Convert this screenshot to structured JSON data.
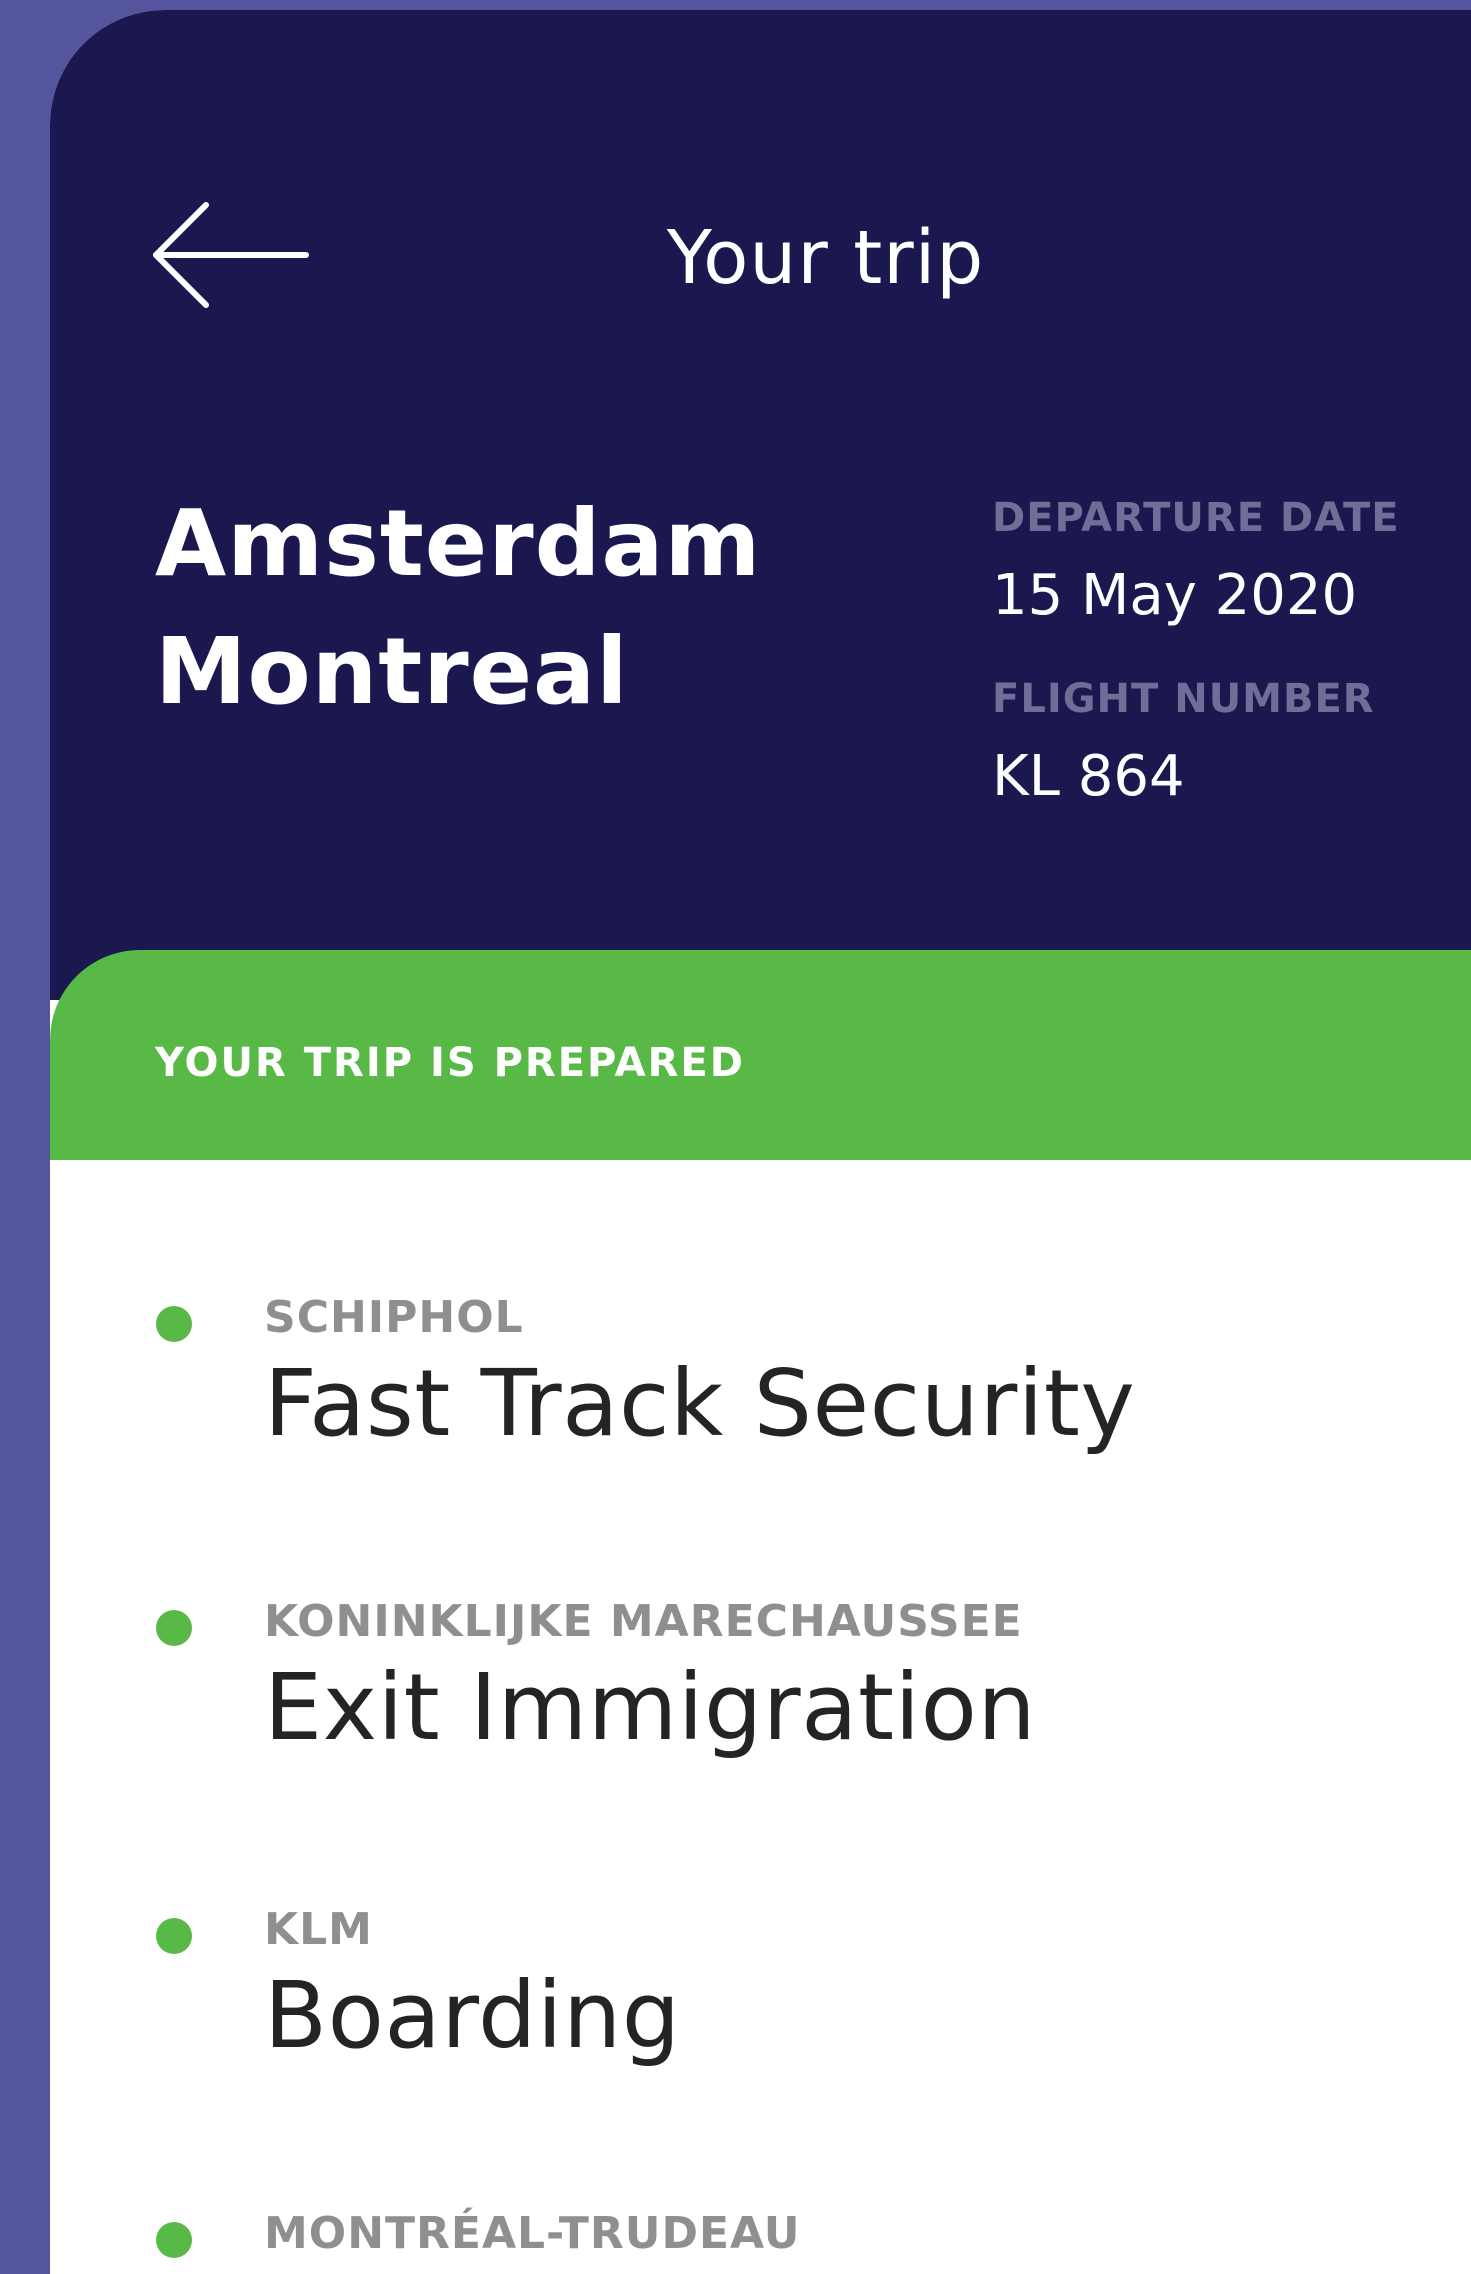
{
  "header": {
    "title": "Your trip",
    "back_icon": "arrow-left-icon"
  },
  "trip": {
    "origin": "Amsterdam",
    "destination": "Montreal",
    "departure_label": "DEPARTURE DATE",
    "departure_date": "15 May 2020",
    "flight_label": "FLIGHT NUMBER",
    "flight_number": "KL 864"
  },
  "status": {
    "text": "YOUR TRIP IS PREPARED",
    "color": "#58b947"
  },
  "steps": [
    {
      "provider": "SCHIPHOL",
      "title": "Fast Track Security"
    },
    {
      "provider": "KONINKLIJKE MARECHAUSSEE",
      "title": "Exit Immigration"
    },
    {
      "provider": "KLM",
      "title": "Boarding"
    },
    {
      "provider": "MONTRÉAL-TRUDEAU",
      "title": ""
    }
  ],
  "colors": {
    "background": "#54559c",
    "header": "#1b1850",
    "accent_green": "#58b947"
  }
}
